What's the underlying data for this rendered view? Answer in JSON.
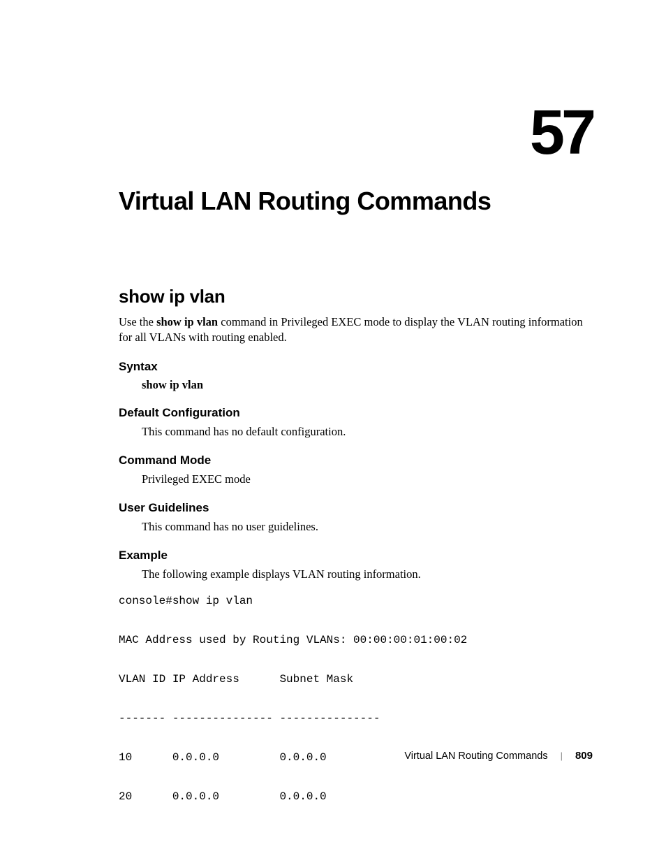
{
  "chapter": {
    "number": "57",
    "title": "Virtual LAN Routing Commands"
  },
  "section": {
    "title": "show ip vlan",
    "intro_prefix": "Use the ",
    "intro_cmd": "show ip vlan",
    "intro_suffix": " command in Privileged EXEC mode to display the VLAN routing information for all VLANs with routing enabled."
  },
  "syntax": {
    "heading": "Syntax",
    "command": "show ip vlan"
  },
  "default_config": {
    "heading": "Default Configuration",
    "text": "This command has no default configuration."
  },
  "command_mode": {
    "heading": "Command Mode",
    "text": "Privileged EXEC mode"
  },
  "user_guidelines": {
    "heading": "User Guidelines",
    "text": "This command has no user guidelines."
  },
  "example": {
    "heading": "Example",
    "text": "The following example displays VLAN routing information.",
    "code": "console#show ip vlan\n\nMAC Address used by Routing VLANs: 00:00:00:01:00:02\n\nVLAN ID IP Address      Subnet Mask\n\n------- --------------- ---------------\n\n10      0.0.0.0         0.0.0.0\n\n20      0.0.0.0         0.0.0.0"
  },
  "footer": {
    "title": "Virtual LAN Routing Commands",
    "page": "809"
  }
}
